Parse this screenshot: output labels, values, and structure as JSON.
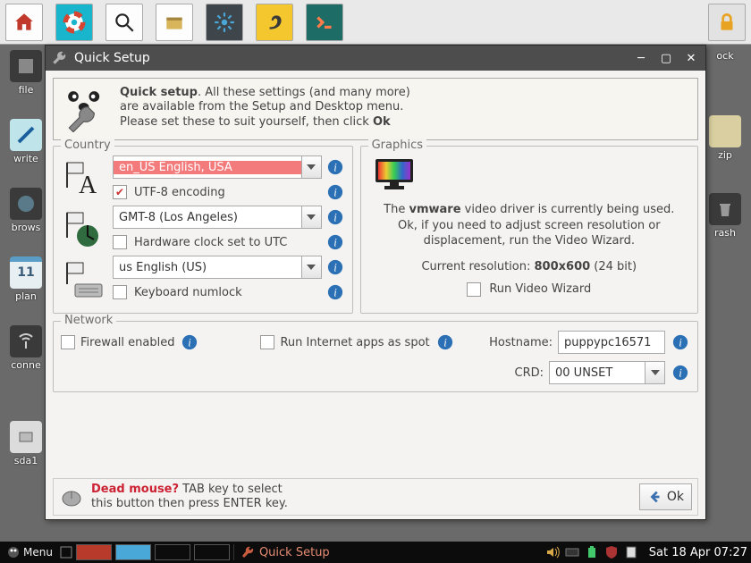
{
  "top_toolbar": {
    "items": [
      "home",
      "help",
      "search",
      "package",
      "settings",
      "lamp",
      "terminal"
    ],
    "lock": "lock"
  },
  "desktop_left": [
    {
      "label": "file"
    },
    {
      "label": "write"
    },
    {
      "label": "brows"
    },
    {
      "label": "plan",
      "badge": "11"
    },
    {
      "label": "conne"
    },
    {
      "label": "sda1"
    }
  ],
  "desktop_right": [
    {
      "label": "ock"
    },
    {
      "label": "zip"
    },
    {
      "label": "rash"
    }
  ],
  "window": {
    "title": "Quick Setup",
    "banner_bold": "Quick setup",
    "banner_text": ". All these settings (and many more) are available from the Setup and Desktop menu. Please set these to suit yourself, then click ",
    "banner_ok": "Ok",
    "country_legend": "Country",
    "graphics_legend": "Graphics",
    "network_legend": "Network",
    "locale_value": "en_US     English, USA",
    "utf8_label": "UTF-8 encoding",
    "tz_value": "GMT-8     (Los Angeles)",
    "hwclock_label": "Hardware clock set to UTC",
    "kbd_value": "us           English (US)",
    "numlock_label": "Keyboard numlock",
    "gfx_text_pre": "The ",
    "gfx_driver": "vmware",
    "gfx_text_post": " video driver is currently being used. Ok, if you need to adjust screen resolution or displacement, run the Video Wizard.",
    "gfx_res_label": "Current resolution: ",
    "gfx_res_value": "800x600",
    "gfx_res_suffix": "   (24 bit)",
    "gfx_wizard_label": "Run Video Wizard",
    "firewall_label": "Firewall enabled",
    "spot_label": "Run Internet apps as spot",
    "hostname_label": "Hostname:",
    "hostname_value": "puppypc16571",
    "crd_label": "CRD:",
    "crd_value": "00 UNSET",
    "dead_mouse_label": "Dead mouse?",
    "dead_mouse_text1": " TAB key to select",
    "dead_mouse_text2": "this button then press ENTER key.",
    "ok_label": "Ok"
  },
  "taskbar": {
    "menu": "Menu",
    "task_label": "Quick Setup",
    "clock": "Sat 18 Apr 07:27"
  }
}
